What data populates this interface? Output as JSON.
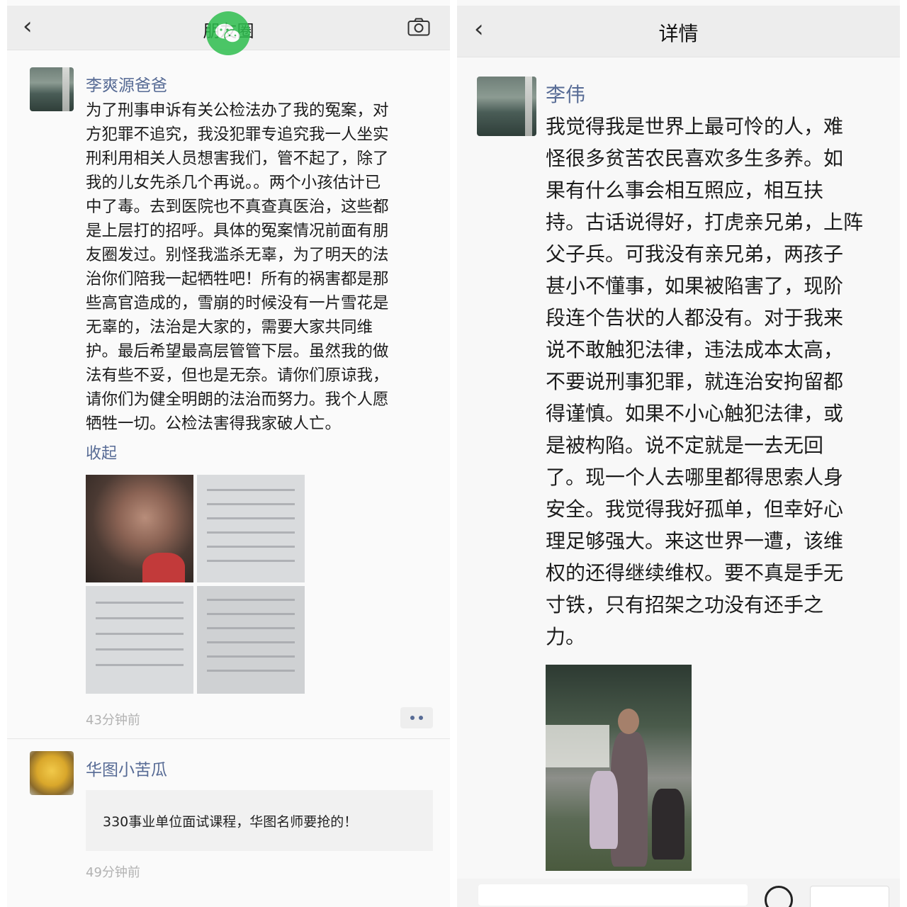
{
  "left": {
    "nav": {
      "back": "‹",
      "title": "朋友圈",
      "camera_icon": "camera-icon"
    },
    "post1": {
      "username": "李爽源爸爸",
      "lines": [
        "为了刑事申诉有关公检法办了我的冤案，对",
        "方犯罪不追究，我没犯罪专追究我一人坐实",
        "刑利用相关人员想害我们，管不起了，除了",
        "我的儿女先杀几个再说。。两个小孩估计已",
        "中了毒。去到医院也不真查真医治，这些都",
        "是上层打的招呼。具体的冤案情况前面有朋",
        "友圈发过。别怪我滥杀无辜，为了明天的法",
        "治你们陪我一起牺牲吧！所有的祸害都是那",
        "些高官造成的，雪崩的时候没有一片雪花是",
        "无辜的，法治是大家的，需要大家共同维",
        "护。最后希望最高层管管下层。虽然我的做",
        "法有些不妥，但也是无奈。请你们原谅我，",
        "请你们为健全明朗的法治而努力。我个人愿",
        "牺牲一切。公检法害得我家破人亡。"
      ],
      "collapse": "收起",
      "time": "43分钟前"
    },
    "post2": {
      "username": "华图小苦瓜",
      "ad_text": "330事业单位面试课程，华图名师要抢的！",
      "time": "49分钟前"
    }
  },
  "right": {
    "nav": {
      "back": "‹",
      "title": "详情"
    },
    "post": {
      "username": "李伟",
      "lines": [
        "我觉得我是世界上最可怜的人，难",
        "怪很多贫苦农民喜欢多生多养。如",
        "果有什么事会相互照应，相互扶",
        "持。古话说得好，打虎亲兄弟，上阵",
        "父子兵。可我没有亲兄弟，两孩子",
        "甚小不懂事，如果被陷害了，现阶",
        "段连个告状的人都没有。对于我来",
        "说不敢触犯法律，违法成本太高，",
        "不要说刑事犯罪，就连治安拘留都",
        "得谨慎。如果不小心触犯法律，或",
        "是被构陷。说不定就是一去无回",
        "了。现一个人去哪里都得思索人身",
        "安全。我觉得我好孤单，但幸好心",
        "理足够强大。来这世界一遭，该维",
        "权的还得继续维权。要不真是手无",
        "寸铁，只有招架之功没有还手之",
        "力。"
      ]
    }
  }
}
